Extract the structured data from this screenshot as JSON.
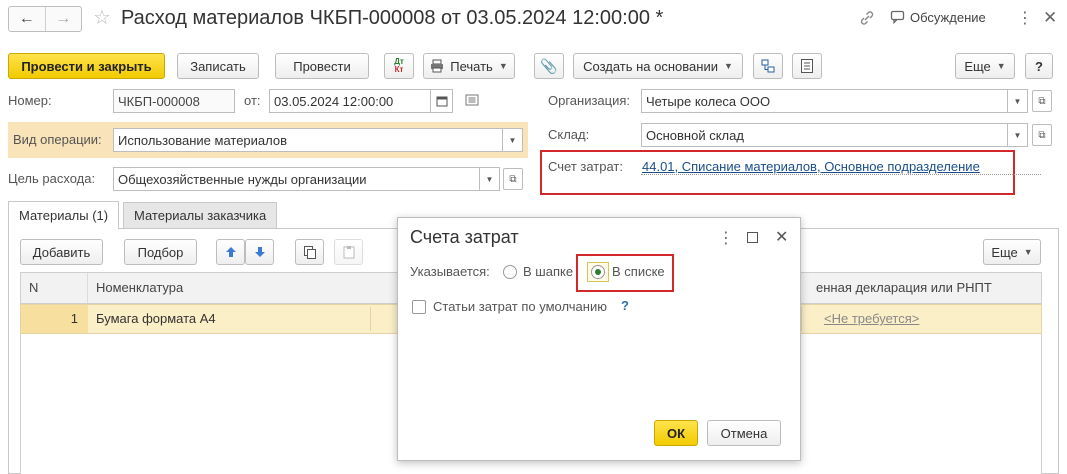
{
  "window": {
    "title": "Расход материалов ЧКБП-000008 от 03.05.2024 12:00:00 *",
    "back_icon": "←",
    "forward_icon": "→",
    "discussion_label": "Обсуждение"
  },
  "toolbar": {
    "post_close": "Провести и закрыть",
    "save": "Записать",
    "post": "Провести",
    "dtkt_top": "Дт",
    "dtkt_bottom": "Кт",
    "print": "Печать",
    "create_based": "Создать на основании",
    "more": "Еще",
    "help": "?"
  },
  "form": {
    "number_label": "Номер:",
    "number_value": "ЧКБП-000008",
    "date_label": "от:",
    "date_value": "03.05.2024 12:00:00",
    "org_label": "Организация:",
    "org_value": "Четыре колеса ООО",
    "warehouse_label": "Склад:",
    "warehouse_value": "Основной склад",
    "op_label": "Вид операции:",
    "op_value": "Использование материалов",
    "cost_account_label": "Счет затрат:",
    "cost_account_value": "44.01, Списание материалов, Основное подразделение",
    "purpose_label": "Цель расхода:",
    "purpose_value": "Общехозяйственные нужды организации"
  },
  "tabs": [
    {
      "label": "Материалы (1)"
    },
    {
      "label": "Материалы заказчика"
    }
  ],
  "table_toolbar": {
    "add": "Добавить",
    "pick": "Подбор",
    "more": "Еще"
  },
  "table": {
    "columns": [
      "N",
      "Номенклатура",
      "енная декларация или РНПТ"
    ],
    "rows": [
      {
        "n": "1",
        "item": "Бумага формата А4",
        "declaration": "<Не требуется>"
      }
    ]
  },
  "dialog": {
    "title": "Счета затрат",
    "specified_label": "Указывается:",
    "option_header": "В шапке",
    "option_list": "В списке",
    "selected_option": "В списке",
    "default_items_label": "Статьи затрат по умолчанию",
    "help": "?",
    "ok": "ОК",
    "cancel": "Отмена"
  },
  "colors": {
    "primary_button": "#f2cb00",
    "highlight_band": "#f9e3b8",
    "selected_row": "#fbefc8",
    "link": "#1a4f8b",
    "annotation_red": "#d3282a",
    "radio_on": "#2e7d32"
  }
}
